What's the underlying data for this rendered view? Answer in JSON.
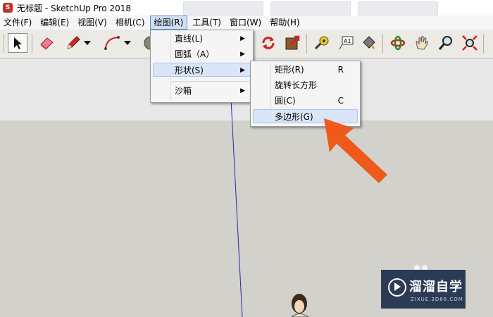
{
  "window": {
    "title": "无标题 - SketchUp Pro 2018"
  },
  "menubar": {
    "items": [
      {
        "label": "文件(F)"
      },
      {
        "label": "编辑(E)"
      },
      {
        "label": "视图(V)"
      },
      {
        "label": "相机(C)"
      },
      {
        "label": "绘图(R)"
      },
      {
        "label": "工具(T)"
      },
      {
        "label": "窗口(W)"
      },
      {
        "label": "帮助(H)"
      }
    ]
  },
  "draw_menu": {
    "items": [
      {
        "label": "直线(L)"
      },
      {
        "label": "圆弧（A）"
      },
      {
        "label": "形状(S)"
      },
      {
        "label": "沙箱"
      }
    ]
  },
  "shapes_submenu": {
    "items": [
      {
        "label": "矩形(R)",
        "shortcut": "R"
      },
      {
        "label": "旋转长方形",
        "shortcut": ""
      },
      {
        "label": "圆(C)",
        "shortcut": "C"
      },
      {
        "label": "多边形(G)",
        "shortcut": ""
      }
    ]
  },
  "watermark": {
    "brand": "溜溜自学",
    "url": "ZIXUE.3D66.COM"
  },
  "colors": {
    "pointer_arrow": "#ef5a1c",
    "menu_highlight": "#d9e6f7",
    "axis_line": "#2a2aa8"
  },
  "icons": [
    "select-arrow-icon",
    "eraser-icon",
    "pencil-icon",
    "arc-icon",
    "circle-icon",
    "orbit-icon",
    "scale-icon",
    "tape-measure-icon",
    "text-label-icon",
    "paint-bucket-icon",
    "rotate-icon",
    "pan-hand-icon",
    "zoom-icon",
    "zoom-extents-icon"
  ]
}
